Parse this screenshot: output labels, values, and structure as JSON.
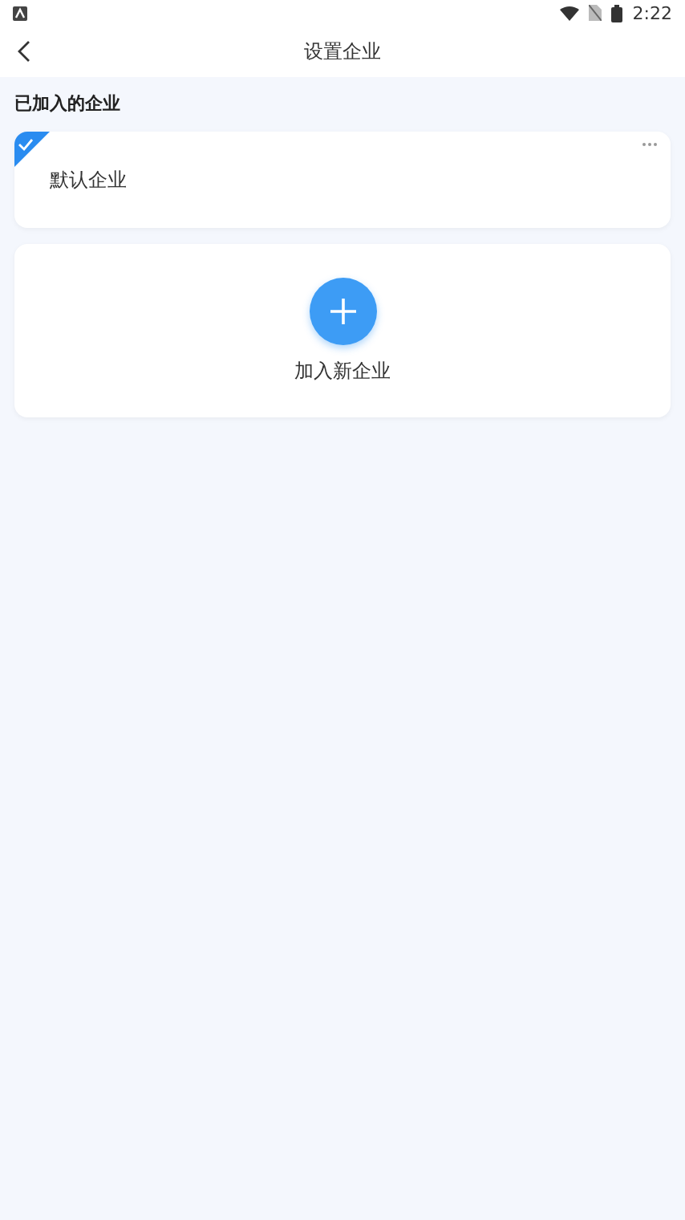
{
  "status_bar": {
    "time": "2:22"
  },
  "header": {
    "title": "设置企业"
  },
  "section_title": "已加入的企业",
  "companies": [
    {
      "name": "默认企业",
      "selected": true
    }
  ],
  "add_card": {
    "label": "加入新企业"
  }
}
